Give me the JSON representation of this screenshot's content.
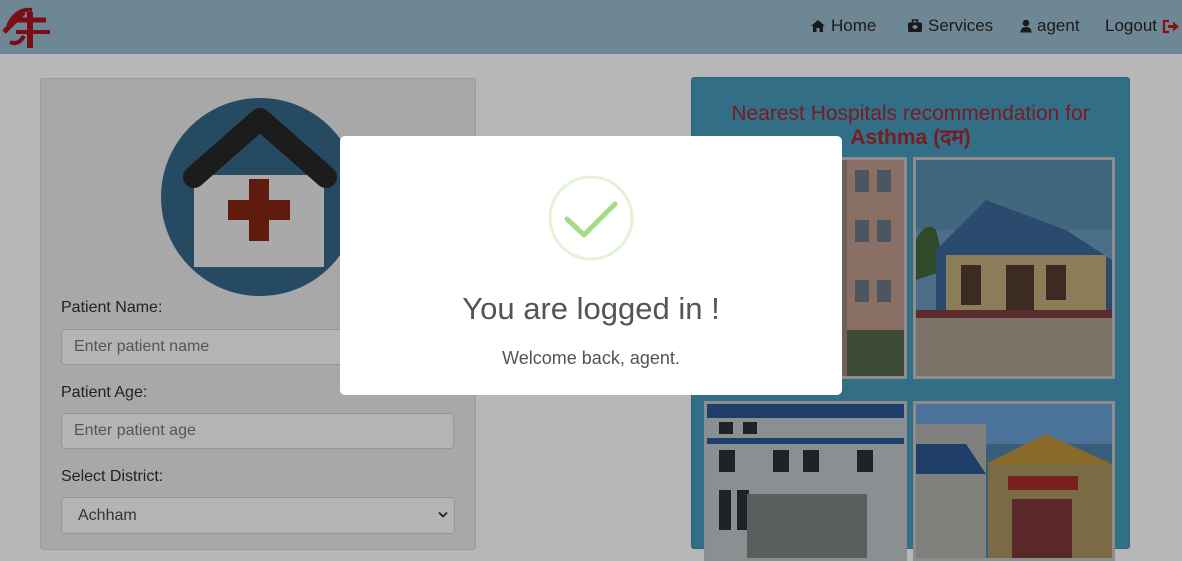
{
  "nav": {
    "logo": "app-logo",
    "items": [
      {
        "label": "Home",
        "icon": "home-icon"
      },
      {
        "label": "Services",
        "icon": "briefcase-icon"
      },
      {
        "label": "agent",
        "icon": "user-icon"
      },
      {
        "label": "Logout",
        "icon": "logout-icon"
      }
    ]
  },
  "form": {
    "patient_name_label": "Patient Name:",
    "patient_name_placeholder": "Enter patient name",
    "patient_age_label": "Patient Age:",
    "patient_age_placeholder": "Enter patient age",
    "district_label": "Select District:",
    "district_value": "Achham"
  },
  "hospitals": {
    "title_prefix": "Nearest Hospitals recommendation for",
    "disease": "Asthma (दम)"
  },
  "modal": {
    "title": "You are logged in !",
    "message": "Welcome back, agent."
  },
  "colors": {
    "accent_red": "#c8102e",
    "success_green": "#a5dc86",
    "panel_teal": "#4fb8d8"
  }
}
